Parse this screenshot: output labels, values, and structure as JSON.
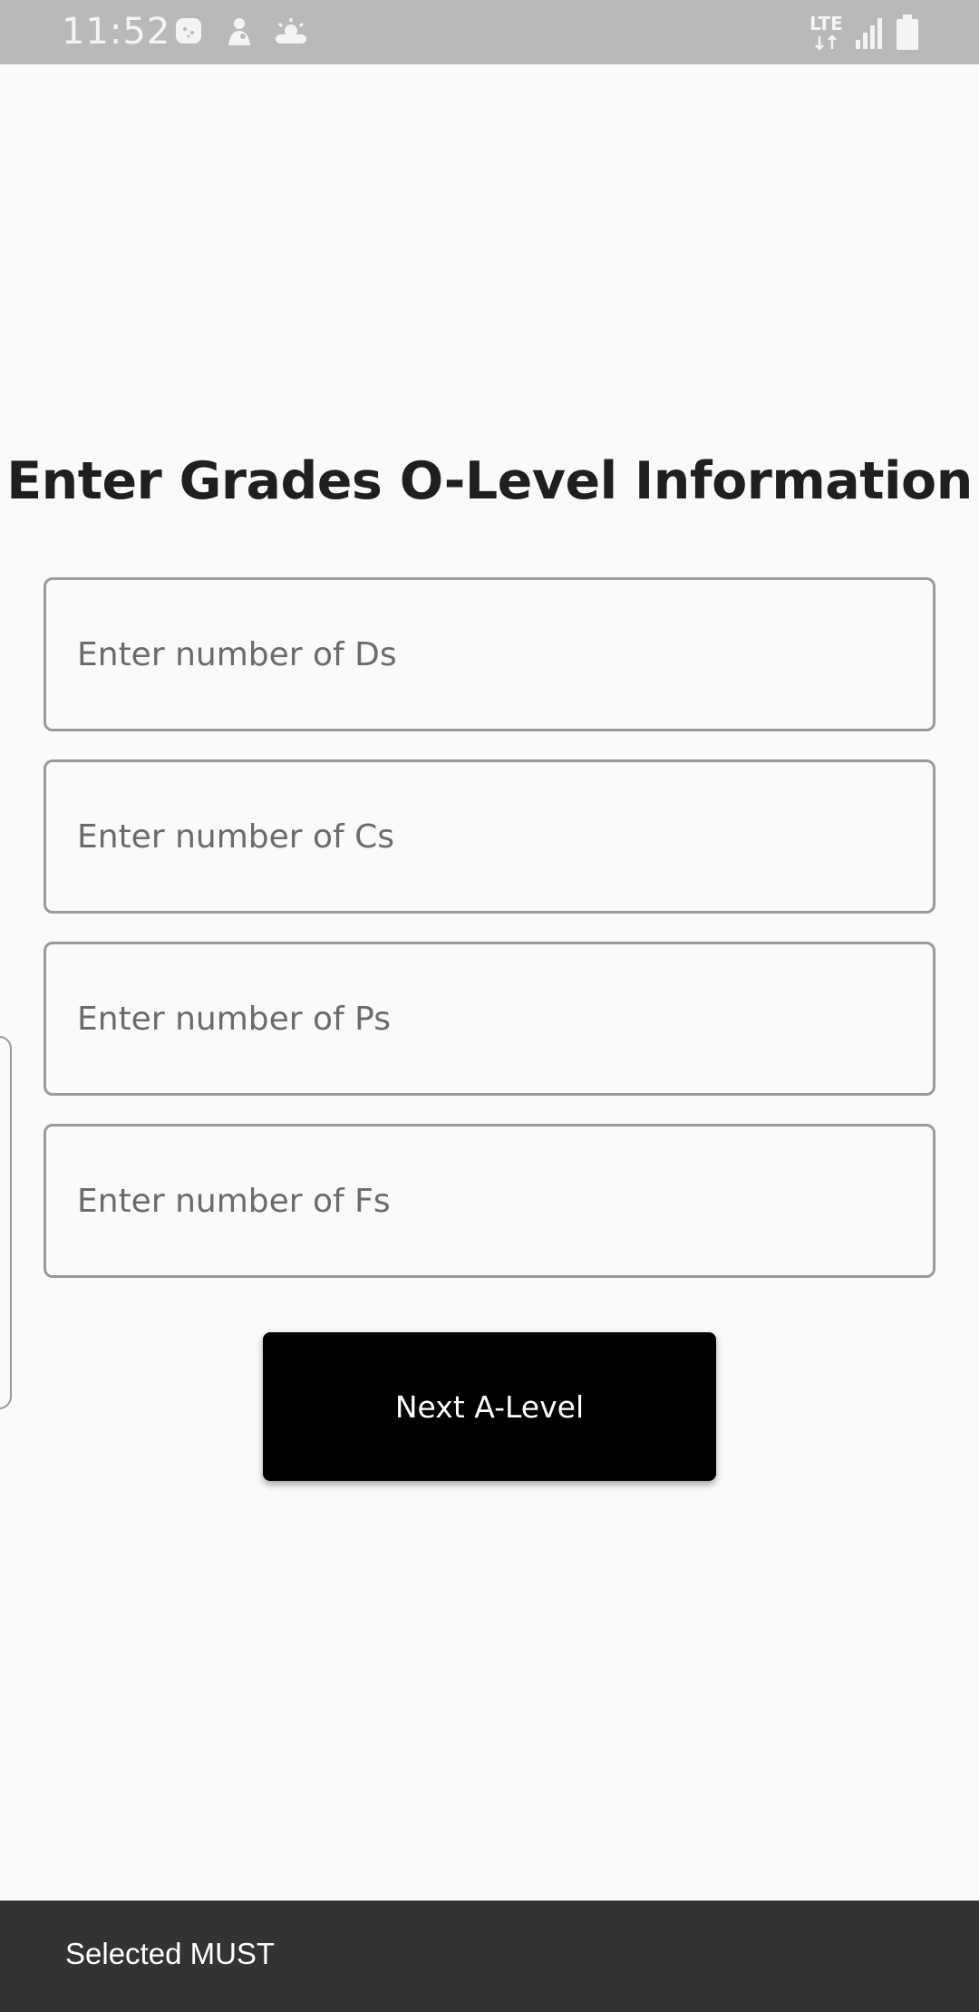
{
  "status_bar": {
    "time": "11:52",
    "network": "LTE",
    "icons": [
      "game-icon",
      "person-icon",
      "weather-icon",
      "data-arrows-icon",
      "signal-icon",
      "battery-icon"
    ]
  },
  "page": {
    "title": "Enter Grades O-Level Information"
  },
  "form": {
    "fields": [
      {
        "placeholder": "Enter number of Ds",
        "value": ""
      },
      {
        "placeholder": "Enter number of Cs",
        "value": ""
      },
      {
        "placeholder": "Enter number of Ps",
        "value": ""
      },
      {
        "placeholder": "Enter number of Fs",
        "value": ""
      }
    ],
    "next_label": "Next A-Level"
  },
  "snackbar": {
    "message": "Selected MUST"
  },
  "colors": {
    "status_bar_bg": "#b9b9b9",
    "page_bg": "#fafafa",
    "button_bg": "#000000",
    "button_text": "#ffffff",
    "snackbar_bg": "#333333",
    "field_border": "#9a9a9a"
  }
}
